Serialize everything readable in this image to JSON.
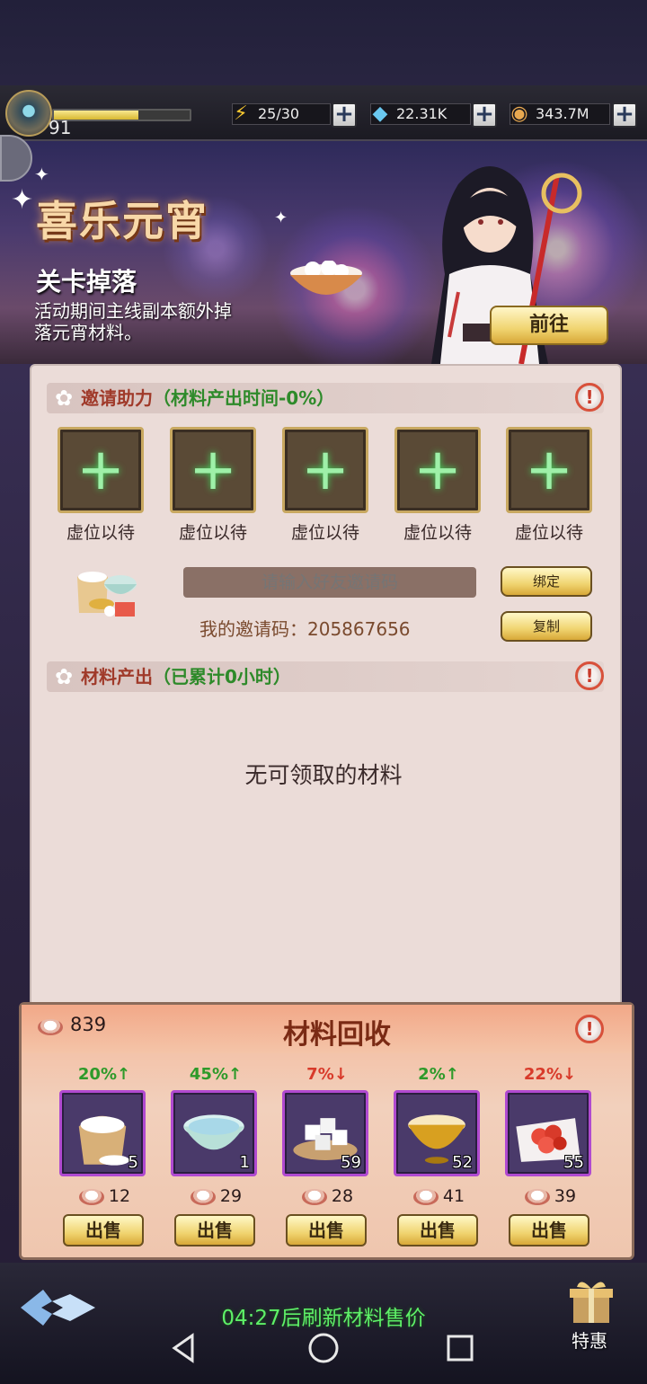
{
  "player": {
    "level": "91",
    "xp_fraction": 0.62
  },
  "resources": {
    "energy": {
      "value": "25/30",
      "icon": "lightning-icon"
    },
    "gems": {
      "value": "22.31K",
      "icon": "diamond-icon"
    },
    "coins": {
      "value": "343.7M",
      "icon": "coin-icon"
    }
  },
  "banner": {
    "title": "喜乐元宵",
    "drop_title": "关卡掉落",
    "drop_desc": "活动期间主线副本额外掉落元宵材料。",
    "goto_label": "前往"
  },
  "invite_section": {
    "title": "邀请助力",
    "subtitle": "（材料产出时间-0%）",
    "slots": [
      {
        "label": "虚位以待"
      },
      {
        "label": "虚位以待"
      },
      {
        "label": "虚位以待"
      },
      {
        "label": "虚位以待"
      },
      {
        "label": "虚位以待"
      }
    ],
    "input_placeholder": "请输入好友邀请码",
    "bind_label": "绑定",
    "my_code_text": "我的邀请码：205867656",
    "copy_label": "复制"
  },
  "material_section": {
    "title": "材料产出",
    "subtitle": "（已累计0小时）",
    "empty_text": "无可领取的材料"
  },
  "recycle": {
    "title": "材料回收",
    "currency_count": "839",
    "items": [
      {
        "name": "flour-sack",
        "change": "20%↑",
        "trend": "up",
        "count": "5",
        "price": "12",
        "sell_label": "出售"
      },
      {
        "name": "water-bowl",
        "change": "45%↑",
        "trend": "up",
        "count": "1",
        "price": "29",
        "sell_label": "出售"
      },
      {
        "name": "sugar-cubes",
        "change": "7%↓",
        "trend": "down",
        "count": "59",
        "price": "28",
        "sell_label": "出售"
      },
      {
        "name": "golden-bowl",
        "change": "2%↑",
        "trend": "up",
        "count": "52",
        "price": "41",
        "sell_label": "出售"
      },
      {
        "name": "red-fruit-plate",
        "change": "22%↓",
        "trend": "down",
        "count": "55",
        "price": "39",
        "sell_label": "出售"
      }
    ]
  },
  "footer": {
    "refresh_text": "04:27后刷新材料售价",
    "special_label": "特惠"
  },
  "colors": {
    "accent_gold": "#f0d470",
    "up": "#2e9a2a",
    "down": "#d83a2a",
    "panel": "#ebdcd8"
  }
}
